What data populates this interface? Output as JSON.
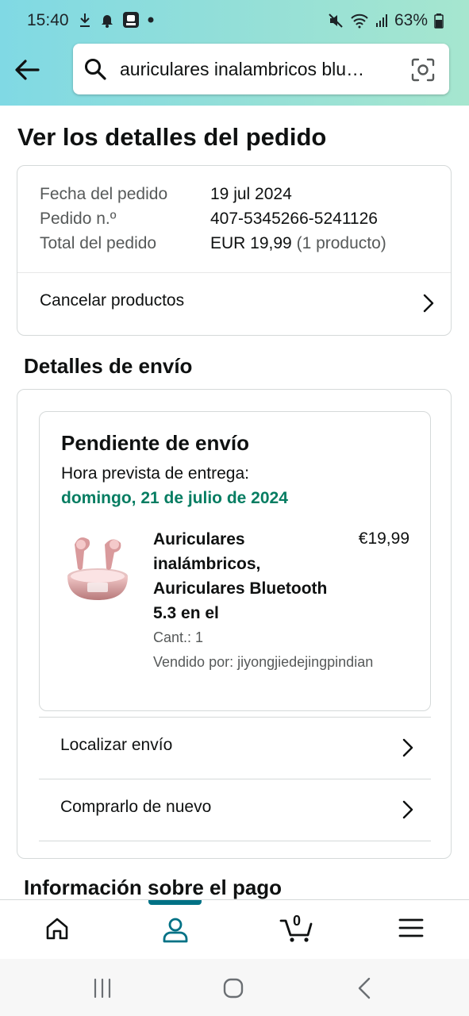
{
  "status_bar": {
    "time": "15:40",
    "battery": "63%",
    "left_icons": [
      "download-icon",
      "bell-icon",
      "app-icon",
      "dot-icon"
    ],
    "right_icons": [
      "mute-icon",
      "wifi-icon",
      "signal-icon",
      "battery-icon"
    ]
  },
  "header": {
    "search_text": "auriculares inalambricos blu…"
  },
  "page": {
    "title": "Ver los detalles del pedido"
  },
  "order_summary": {
    "rows": [
      {
        "label": "Fecha del pedido",
        "value": "19 jul 2024"
      },
      {
        "label": "Pedido n.º",
        "value": "407-5345266-5241126"
      },
      {
        "label": "Total del pedido",
        "value": "EUR 19,99",
        "extra": "(1 producto)"
      }
    ],
    "cancel_label": "Cancelar productos"
  },
  "shipping": {
    "section_title": "Detalles de envío",
    "status": "Pendiente de envío",
    "eta_label": "Hora prevista de entrega:",
    "eta_date": "domingo, 21 de julio de 2024",
    "product": {
      "name": "Auriculares inalámbricos, Auriculares Bluetooth 5.3 en el",
      "price": "€19,99",
      "quantity": "Cant.: 1",
      "seller": "Vendido por: jiyongjiedejingpindian"
    },
    "links": [
      "Localizar envío",
      "Comprarlo de nuevo"
    ]
  },
  "payment": {
    "section_title": "Información sobre el pago"
  },
  "tab_bar": {
    "cart_count": "0",
    "active_tab": "account",
    "accent_color": "#007185"
  },
  "colors": {
    "delivery_green": "#067d62",
    "header_gradient_start": "#80d9e4",
    "header_gradient_end": "#a6e6cf"
  }
}
